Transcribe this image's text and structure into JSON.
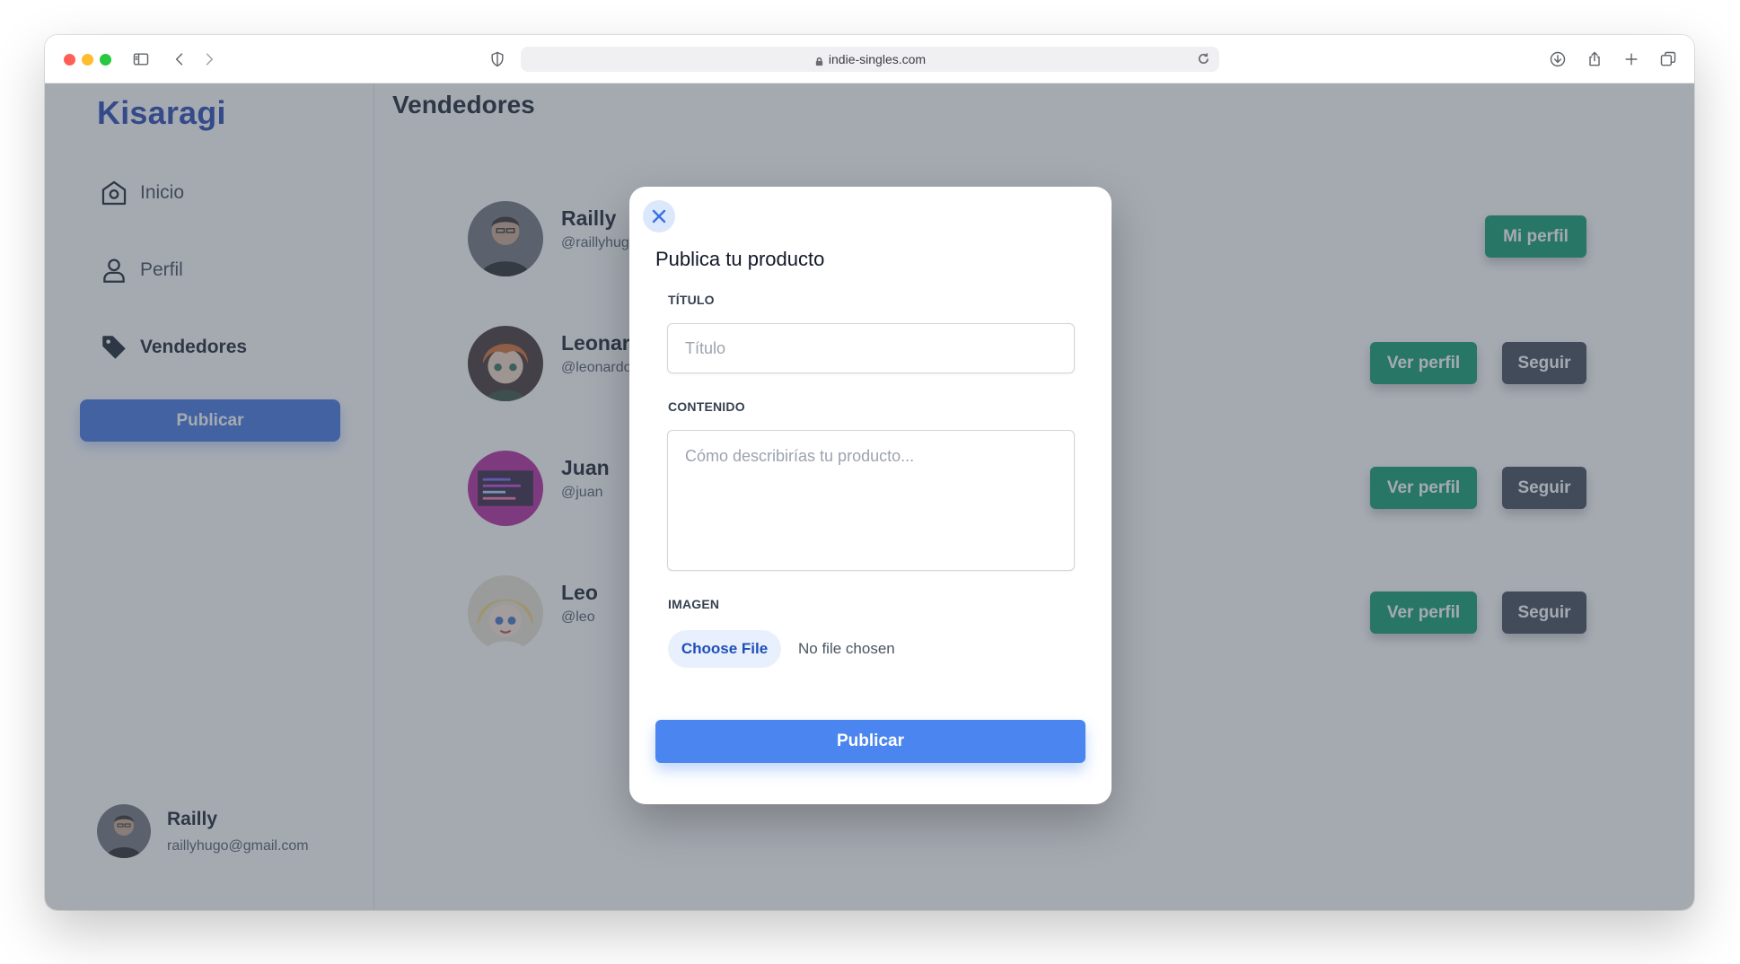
{
  "browser": {
    "url": "indie-singles.com",
    "colors": {
      "red": "#ff5f57",
      "yellow": "#febc2e",
      "green": "#28c840"
    },
    "icons": [
      "sidebar-toggle-icon",
      "back-icon",
      "forward-icon",
      "shield-icon",
      "lock-icon",
      "reload-icon",
      "download-icon",
      "share-icon",
      "new-tab-icon",
      "tabs-overview-icon"
    ]
  },
  "sidebar": {
    "brand": "Kisaragi",
    "brand_color": "#1e40af",
    "nav": [
      {
        "label": "Inicio",
        "icon": "home-icon",
        "active": false
      },
      {
        "label": "Perfil",
        "icon": "user-icon",
        "active": false
      },
      {
        "label": "Vendedores",
        "icon": "tag-icon",
        "active": true
      }
    ],
    "publish_label": "Publicar",
    "publish_color": "#3b6fe0",
    "current_user": {
      "name": "Railly",
      "email": "raillyhugo@gmail.com"
    }
  },
  "main": {
    "title": "Vendedores",
    "sellers": [
      {
        "name": "Railly",
        "handle": "@raillyhugo",
        "actions": [
          "Mi perfil"
        ]
      },
      {
        "name": "Leonardo",
        "handle": "@leonardo",
        "actions": [
          "Ver perfil",
          "Seguir"
        ]
      },
      {
        "name": "Juan",
        "handle": "@juan",
        "actions": [
          "Ver perfil",
          "Seguir"
        ]
      },
      {
        "name": "Leo",
        "handle": "@leo",
        "actions": [
          "Ver perfil",
          "Seguir"
        ]
      }
    ],
    "button_colors": {
      "green": "#059669",
      "dark": "#374151"
    }
  },
  "modal": {
    "title": "Publica tu producto",
    "fields": {
      "title_label": "TÍTULO",
      "title_placeholder": "Título",
      "content_label": "CONTENIDO",
      "content_placeholder": "Cómo describirías tu producto...",
      "image_label": "IMAGEN",
      "file_button": "Choose File",
      "file_status": "No file chosen"
    },
    "submit_label": "Publicar",
    "submit_color": "#4b86f0",
    "close_icon": "close-icon"
  }
}
